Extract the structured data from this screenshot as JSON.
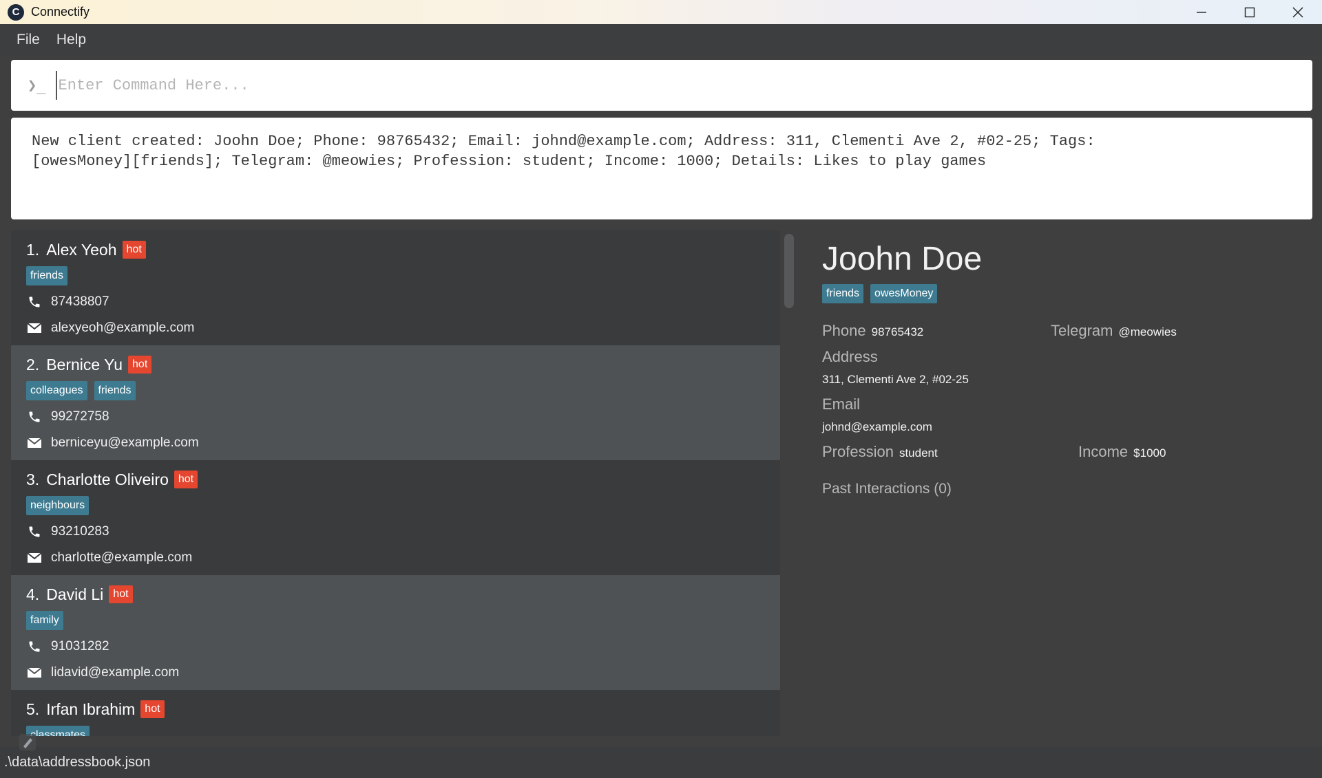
{
  "window": {
    "title": "Connectify",
    "icon_letter": "C"
  },
  "menu": [
    "File",
    "Help"
  ],
  "command": {
    "placeholder": "Enter Command Here...",
    "prompt_symbol": "❯_"
  },
  "result": {
    "text": "New client created: Joohn Doe; Phone: 98765432; Email: johnd@example.com; Address: 311, Clementi Ave 2, #02-25; Tags:\n[owesMoney][friends]; Telegram: @meowies; Profession: student; Income: 1000; Details: Likes to play games"
  },
  "persons": [
    {
      "index": "1.",
      "name": "Alex Yeoh",
      "badge": "hot",
      "tags": [
        "friends"
      ],
      "phone": "87438807",
      "email": "alexyeoh@example.com"
    },
    {
      "index": "2.",
      "name": "Bernice Yu",
      "badge": "hot",
      "tags": [
        "colleagues",
        "friends"
      ],
      "phone": "99272758",
      "email": "berniceyu@example.com"
    },
    {
      "index": "3.",
      "name": "Charlotte Oliveiro",
      "badge": "hot",
      "tags": [
        "neighbours"
      ],
      "phone": "93210283",
      "email": "charlotte@example.com"
    },
    {
      "index": "4.",
      "name": "David Li",
      "badge": "hot",
      "tags": [
        "family"
      ],
      "phone": "91031282",
      "email": "lidavid@example.com"
    },
    {
      "index": "5.",
      "name": "Irfan Ibrahim",
      "badge": "hot",
      "tags": [
        "classmates"
      ],
      "phone": "",
      "email": ""
    }
  ],
  "detail": {
    "name": "Joohn Doe",
    "tags": [
      "friends",
      "owesMoney"
    ],
    "phone_label": "Phone",
    "phone": "98765432",
    "telegram_label": "Telegram",
    "telegram": "@meowies",
    "address_label": "Address",
    "address": "311, Clementi Ave 2, #02-25",
    "email_label": "Email",
    "email": "johnd@example.com",
    "profession_label": "Profession",
    "profession": "student",
    "income_label": "Income",
    "income": "$1000",
    "interactions_label": "Past Interactions (0)"
  },
  "status": {
    "path": ".\\data\\addressbook.json"
  },
  "colors": {
    "hot": "#e4462f",
    "tag": "#3e7b91",
    "background": "#3f3f3f"
  }
}
